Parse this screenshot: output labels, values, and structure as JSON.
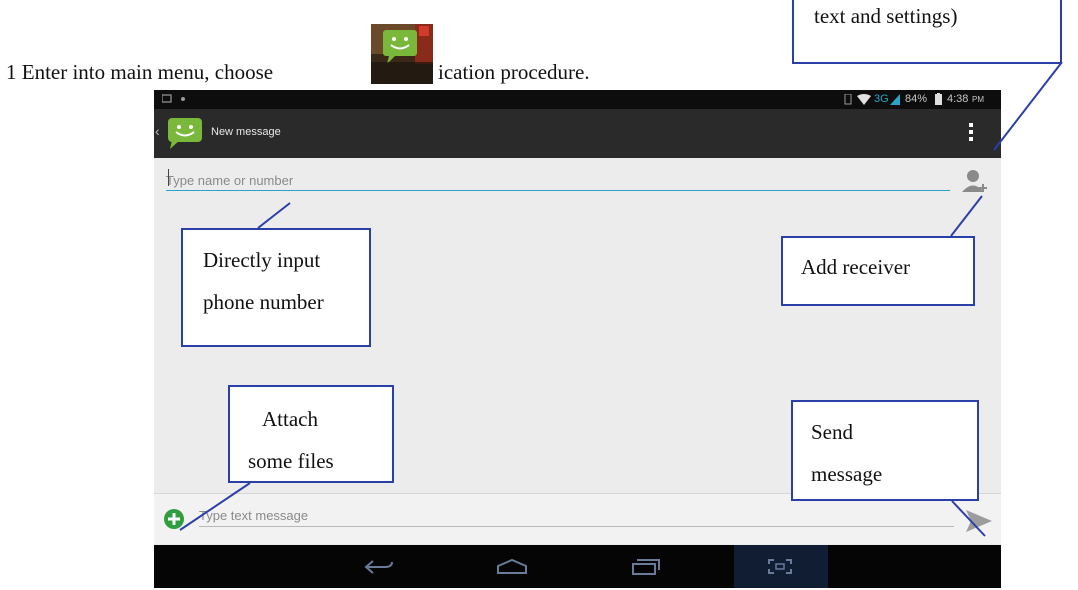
{
  "instruction": {
    "text_before_icon": "1 Enter into main menu, choose",
    "text_after_icon": "ication  procedure."
  },
  "callouts": {
    "top_right": "text and settings)",
    "direct_input_line1": "Directly    input",
    "direct_input_line2": "phone number",
    "add_receiver": "Add receiver",
    "attach_line1": "Attach",
    "attach_line2": "some files",
    "send_line1": "Send",
    "send_line2": "message"
  },
  "status_bar": {
    "network": "3G",
    "battery": "84%",
    "time": "4:38",
    "ampm": "PM"
  },
  "action_bar": {
    "title": "New message"
  },
  "to_field": {
    "placeholder": "Type name or number",
    "value": ""
  },
  "compose": {
    "placeholder": "Type text message",
    "value": ""
  },
  "icons": {
    "app": "messaging-smiley-icon",
    "add_contact": "add-contact-icon",
    "attach": "plus-circle-icon",
    "send": "send-arrow-icon",
    "overflow": "overflow-menu-icon",
    "nav": [
      "back-icon",
      "home-icon",
      "recent-apps-icon",
      "screenshot-icon"
    ]
  },
  "colors": {
    "accent": "#2aa3c8",
    "app_green": "#79b83a",
    "callout_border": "#2b3fa8",
    "attach_green": "#2e9e3f"
  }
}
